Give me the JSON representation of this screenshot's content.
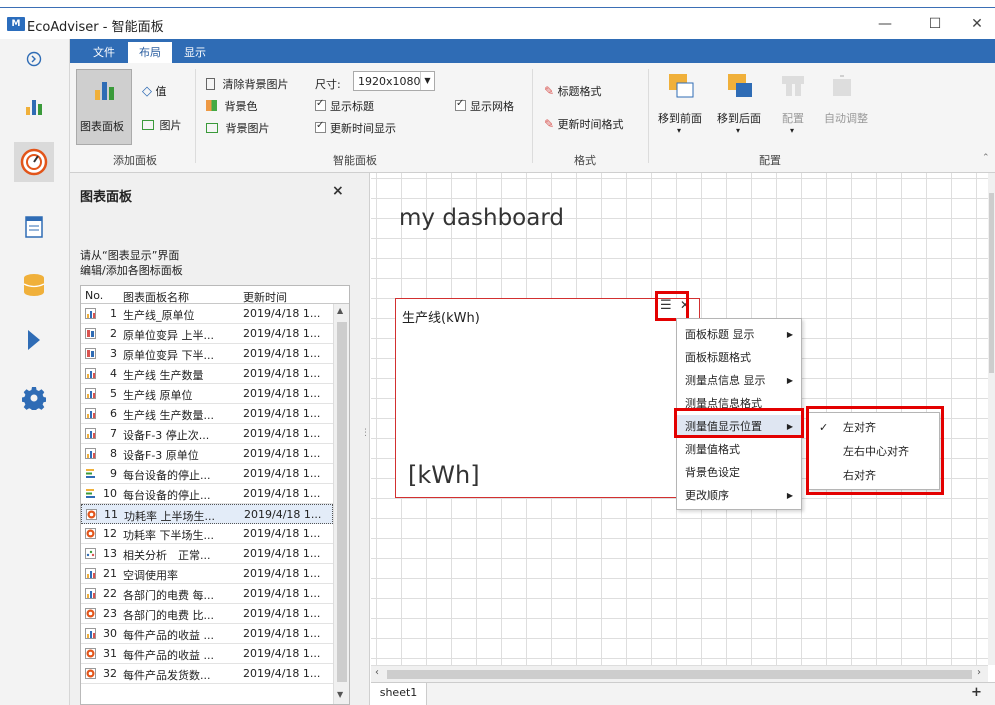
{
  "window": {
    "app_name": "EcoAdviser - 智能面板",
    "logo_text": "M",
    "controls": [
      "—",
      "☐",
      "✕"
    ]
  },
  "left_rail": {
    "items": [
      "back",
      "chart",
      "dashboard",
      "report",
      "database",
      "run",
      "settings"
    ],
    "accent": "#2f6cb5"
  },
  "ribbon_tabs": [
    "文件",
    "布局",
    "显示"
  ],
  "ribbon": {
    "add_panel": {
      "chart_panel": "图表面板",
      "value": "值",
      "image": "图片",
      "group_label": "添加面板"
    },
    "smart_panel": {
      "clear_bg_image": "清除背景图片",
      "size_label": "尺寸:",
      "size_value": "1920x1080",
      "bg_color": "背景色",
      "show_title": "显示标题",
      "show_grid": "显示网格",
      "bg_image": "背景图片",
      "update_time_show": "更新时间显示",
      "group_label": "智能面板"
    },
    "format": {
      "title_format": "标题格式",
      "update_time_format": "更新时间格式",
      "group_label": "格式"
    },
    "arrange": {
      "bring_front": "移到前面",
      "send_back": "移到后面",
      "align": "配置",
      "auto_adjust": "自动调整",
      "group_label": "配置"
    }
  },
  "panel": {
    "title": "图表面板",
    "close": "×",
    "hint_line1": "请从“图表显示”界面",
    "hint_line2": "编辑/添加各图标面板",
    "columns": [
      "No.",
      "图表面板名称",
      "更新时间"
    ],
    "rows": [
      {
        "no": "1",
        "name": "生产线_原单位",
        "time": "2019/4/18 1...",
        "icon": "bar"
      },
      {
        "no": "2",
        "name": "原单位变异 上半...",
        "time": "2019/4/18 1...",
        "icon": "candle"
      },
      {
        "no": "3",
        "name": "原单位变异 下半...",
        "time": "2019/4/18 1...",
        "icon": "candle"
      },
      {
        "no": "4",
        "name": "生产线 生产数量",
        "time": "2019/4/18 1...",
        "icon": "bar"
      },
      {
        "no": "5",
        "name": "生产线 原单位",
        "time": "2019/4/18 1...",
        "icon": "bar"
      },
      {
        "no": "6",
        "name": "生产线 生产数量...",
        "time": "2019/4/18 1...",
        "icon": "bar"
      },
      {
        "no": "7",
        "name": "设备F-3 停止次...",
        "time": "2019/4/18 1...",
        "icon": "bar"
      },
      {
        "no": "8",
        "name": "设备F-3 原单位",
        "time": "2019/4/18 1...",
        "icon": "bar"
      },
      {
        "no": "9",
        "name": "每台设备的停止...",
        "time": "2019/4/18 1...",
        "icon": "hbar"
      },
      {
        "no": "10",
        "name": "每台设备的停止...",
        "time": "2019/4/18 1...",
        "icon": "hbar"
      },
      {
        "no": "11",
        "name": "功耗率 上半场生...",
        "time": "2019/4/18 1...",
        "icon": "gauge"
      },
      {
        "no": "12",
        "name": "功耗率 下半场生...",
        "time": "2019/4/18 1...",
        "icon": "gauge"
      },
      {
        "no": "13",
        "name": "相关分析　正常...",
        "time": "2019/4/18 1...",
        "icon": "scatter"
      },
      {
        "no": "21",
        "name": "空调使用率",
        "time": "2019/4/18 1...",
        "icon": "bar"
      },
      {
        "no": "22",
        "name": "各部门的电费 每...",
        "time": "2019/4/18 1...",
        "icon": "bar"
      },
      {
        "no": "23",
        "name": "各部门的电费 比...",
        "time": "2019/4/18 1...",
        "icon": "gauge"
      },
      {
        "no": "30",
        "name": "每件产品的收益 ...",
        "time": "2019/4/18 1...",
        "icon": "bar"
      },
      {
        "no": "31",
        "name": "每件产品的收益 ...",
        "time": "2019/4/18 1...",
        "icon": "gauge"
      },
      {
        "no": "32",
        "name": "每件产品发货数...",
        "time": "2019/4/18 1...",
        "icon": "gauge"
      }
    ],
    "selected_row": "11"
  },
  "canvas": {
    "dashboard_title": "my dashboard",
    "panel_title": "生产线(kWh)",
    "panel_unit": "[kWh]",
    "panel_menu_icon": "☰",
    "panel_close_icon": "✕"
  },
  "context_menu": {
    "items": [
      {
        "label": "面板标题 显示",
        "submenu": true
      },
      {
        "label": "面板标题格式",
        "submenu": false
      },
      {
        "label": "测量点信息  显示",
        "submenu": true
      },
      {
        "label": "测量点信息格式",
        "submenu": false
      },
      {
        "label": "测量值显示位置",
        "submenu": true
      },
      {
        "label": "测量值格式",
        "submenu": false
      },
      {
        "label": "背景色设定",
        "submenu": false
      },
      {
        "label": "更改顺序",
        "submenu": true
      }
    ]
  },
  "submenu": {
    "items": [
      "左对齐",
      "左右中心对齐",
      "右对齐"
    ],
    "checked": "左对齐"
  },
  "sheet_tab": "sheet1",
  "highlight_color": "#e30000"
}
